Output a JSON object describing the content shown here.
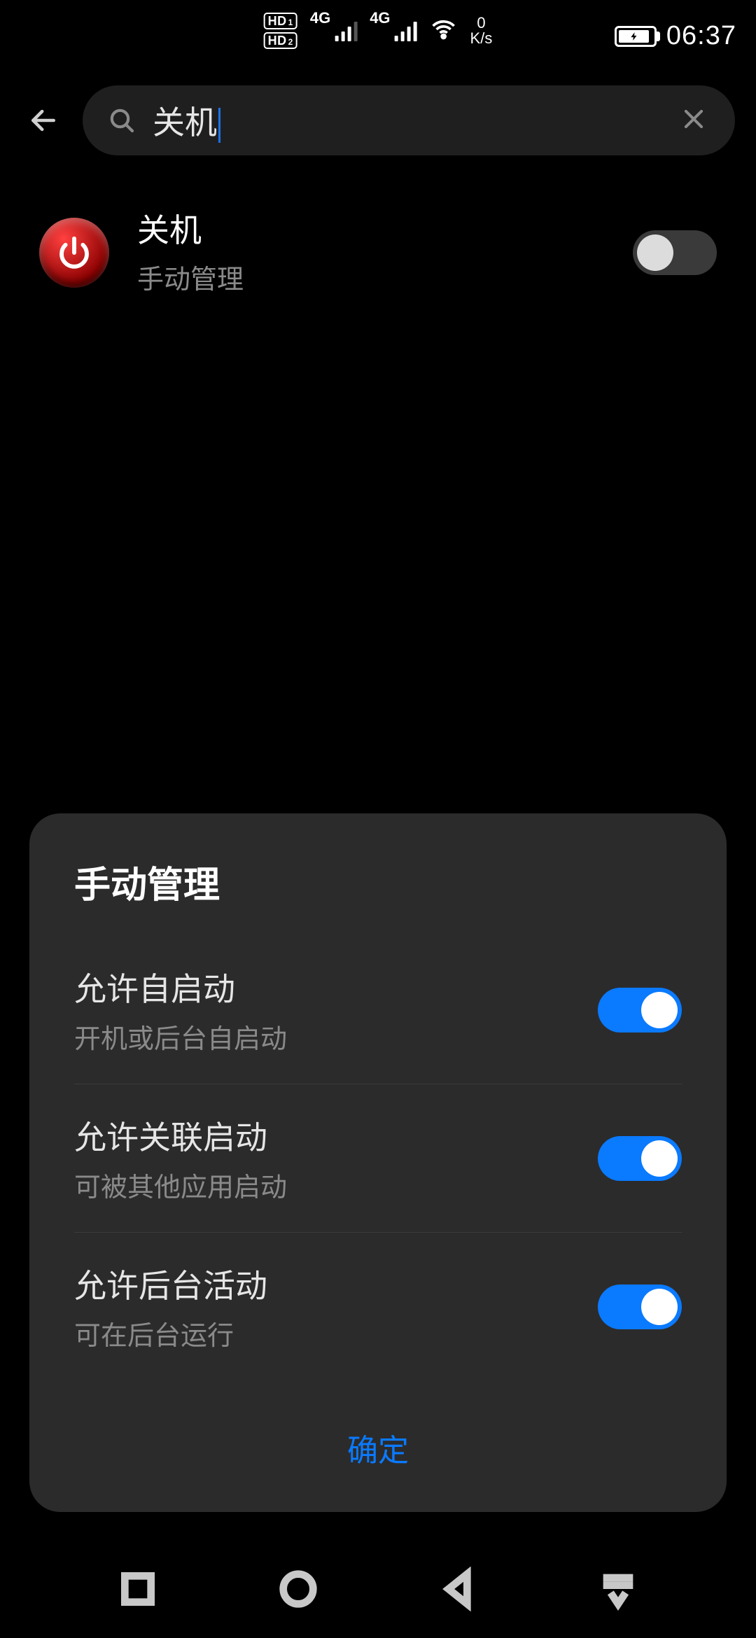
{
  "status": {
    "hd1": "HD",
    "hd1_sub": "1",
    "hd2": "HD",
    "hd2_sub": "2",
    "sig1_label": "4G",
    "sig2_label": "4G",
    "speed_num": "0",
    "speed_unit": "K/s",
    "time": "06:37"
  },
  "search": {
    "value": "关机"
  },
  "result": {
    "title": "关机",
    "subtitle": "手动管理",
    "toggle_on": false
  },
  "sheet": {
    "title": "手动管理",
    "items": [
      {
        "label": "允许自启动",
        "desc": "开机或后台自启动",
        "on": true
      },
      {
        "label": "允许关联启动",
        "desc": "可被其他应用启动",
        "on": true
      },
      {
        "label": "允许后台活动",
        "desc": "可在后台运行",
        "on": true
      }
    ],
    "confirm": "确定"
  }
}
